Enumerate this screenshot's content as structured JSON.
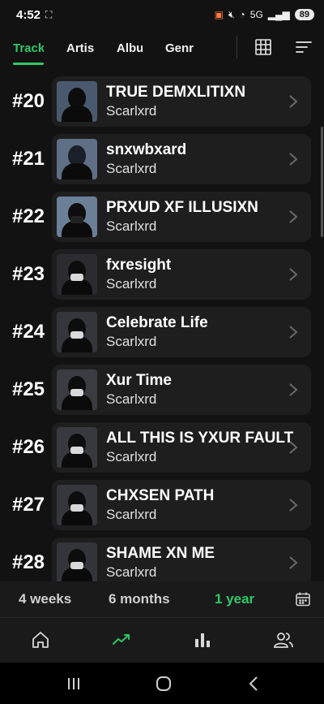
{
  "status_bar": {
    "time": "4:52",
    "screen_icon": "screenshot-frame-icon",
    "network": "5G",
    "battery": "89"
  },
  "tabs": [
    {
      "label": "Track",
      "active": true
    },
    {
      "label": "Artis",
      "active": false
    },
    {
      "label": "Albu",
      "active": false
    },
    {
      "label": "Genr",
      "active": false
    }
  ],
  "toolbar": {
    "grid_icon": "grid-view-icon",
    "sort_icon": "sort-icon"
  },
  "tracks": [
    {
      "rank": "#20",
      "title": "TRUE DEMXLITIXN",
      "artist": "Scarlxrd"
    },
    {
      "rank": "#21",
      "title": "snxwbxard",
      "artist": "Scarlxrd"
    },
    {
      "rank": "#22",
      "title": "PRXUD XF ILLUSIXN",
      "artist": "Scarlxrd"
    },
    {
      "rank": "#23",
      "title": "fxresight",
      "artist": "Scarlxrd"
    },
    {
      "rank": "#24",
      "title": "Celebrate Life",
      "artist": "Scarlxrd"
    },
    {
      "rank": "#25",
      "title": "Xur Time",
      "artist": "Scarlxrd"
    },
    {
      "rank": "#26",
      "title": "ALL THIS IS YXUR FAULT",
      "artist": "Scarlxrd"
    },
    {
      "rank": "#27",
      "title": "CHXSEN PATH",
      "artist": "Scarlxrd"
    },
    {
      "rank": "#28",
      "title": "SHAME XN ME",
      "artist": "Scarlxrd"
    }
  ],
  "periods": [
    {
      "label": "4 weeks",
      "active": false
    },
    {
      "label": "6 months",
      "active": false
    },
    {
      "label": "1 year",
      "active": true
    }
  ],
  "colors": {
    "accent": "#2ec866",
    "background": "#121212",
    "card": "#1e1e1e"
  }
}
